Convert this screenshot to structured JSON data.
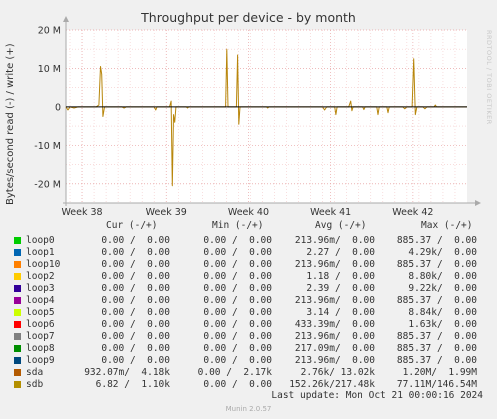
{
  "chart_data": {
    "type": "line",
    "title": "Throughput per device - by month",
    "ylabel": "Bytes/second read (-) / write (+)",
    "ylim": [
      -25000000,
      20000000
    ],
    "yticks": [
      {
        "value": 20000000,
        "label": "20 M"
      },
      {
        "value": 10000000,
        "label": "10 M"
      },
      {
        "value": 0,
        "label": "0"
      },
      {
        "value": -10000000,
        "label": "-10 M"
      },
      {
        "value": -20000000,
        "label": "-20 M"
      }
    ],
    "xlim": [
      0,
      1
    ],
    "xticks": [
      {
        "value": 0.04,
        "label": "Week 38"
      },
      {
        "value": 0.25,
        "label": "Week 39"
      },
      {
        "value": 0.455,
        "label": "Week 40"
      },
      {
        "value": 0.66,
        "label": "Week 41"
      },
      {
        "value": 0.865,
        "label": "Week 42"
      }
    ],
    "grid": true,
    "series": [
      {
        "name": "sdb",
        "color": "#b8860b",
        "points": [
          [
            0.0,
            0
          ],
          [
            0.005,
            -800000
          ],
          [
            0.01,
            0
          ],
          [
            0.02,
            -300000
          ],
          [
            0.03,
            0
          ],
          [
            0.075,
            0
          ],
          [
            0.082,
            500000
          ],
          [
            0.086,
            10500000
          ],
          [
            0.089,
            8500000
          ],
          [
            0.092,
            -2500000
          ],
          [
            0.096,
            0
          ],
          [
            0.14,
            0
          ],
          [
            0.145,
            -300000
          ],
          [
            0.15,
            0
          ],
          [
            0.22,
            0
          ],
          [
            0.224,
            -800000
          ],
          [
            0.227,
            0
          ],
          [
            0.258,
            0
          ],
          [
            0.262,
            1500000
          ],
          [
            0.265,
            -20500000
          ],
          [
            0.268,
            -2000000
          ],
          [
            0.271,
            -4000000
          ],
          [
            0.274,
            0
          ],
          [
            0.3,
            0
          ],
          [
            0.303,
            -300000
          ],
          [
            0.306,
            0
          ],
          [
            0.398,
            0
          ],
          [
            0.401,
            15000000
          ],
          [
            0.404,
            0
          ],
          [
            0.425,
            0
          ],
          [
            0.428,
            13500000
          ],
          [
            0.431,
            -4500000
          ],
          [
            0.434,
            0
          ],
          [
            0.5,
            0
          ],
          [
            0.503,
            -300000
          ],
          [
            0.506,
            0
          ],
          [
            0.64,
            0
          ],
          [
            0.645,
            -800000
          ],
          [
            0.65,
            0
          ],
          [
            0.67,
            0
          ],
          [
            0.673,
            -2000000
          ],
          [
            0.676,
            0
          ],
          [
            0.705,
            0
          ],
          [
            0.71,
            1500000
          ],
          [
            0.713,
            -1000000
          ],
          [
            0.716,
            0
          ],
          [
            0.74,
            0
          ],
          [
            0.743,
            -700000
          ],
          [
            0.746,
            0
          ],
          [
            0.775,
            0
          ],
          [
            0.778,
            -2000000
          ],
          [
            0.781,
            0
          ],
          [
            0.8,
            0
          ],
          [
            0.803,
            -1500000
          ],
          [
            0.806,
            0
          ],
          [
            0.84,
            0
          ],
          [
            0.845,
            -500000
          ],
          [
            0.85,
            0
          ],
          [
            0.863,
            0
          ],
          [
            0.867,
            12500000
          ],
          [
            0.871,
            -2000000
          ],
          [
            0.875,
            0
          ],
          [
            0.89,
            0
          ],
          [
            0.895,
            -500000
          ],
          [
            0.9,
            0
          ],
          [
            0.918,
            0
          ],
          [
            0.921,
            500000
          ],
          [
            0.924,
            0
          ],
          [
            1.0,
            0
          ]
        ]
      },
      {
        "name": "loop0",
        "color": "#000000",
        "points": [
          [
            0.0,
            0
          ],
          [
            1.0,
            0
          ]
        ]
      }
    ]
  },
  "side_label": "RRDTOOL / TOBI OETIKER",
  "legend": {
    "columns": [
      "Cur (-/+)",
      "Min (-/+)",
      "Avg (-/+)",
      "Max (-/+)"
    ],
    "rows": [
      {
        "name": "loop0",
        "color": "#00cc00",
        "cur": "0.00 /  0.00",
        "min": "0.00 /  0.00",
        "avg": "213.96m/  0.00",
        "max": "885.37 /  0.00"
      },
      {
        "name": "loop1",
        "color": "#0066b3",
        "cur": "0.00 /  0.00",
        "min": "0.00 /  0.00",
        "avg": "2.27 /  0.00",
        "max": "4.29k/  0.00"
      },
      {
        "name": "loop10",
        "color": "#ff8000",
        "cur": "0.00 /  0.00",
        "min": "0.00 /  0.00",
        "avg": "213.96m/  0.00",
        "max": "885.37 /  0.00"
      },
      {
        "name": "loop2",
        "color": "#ffcc00",
        "cur": "0.00 /  0.00",
        "min": "0.00 /  0.00",
        "avg": "1.18 /  0.00",
        "max": "8.80k/  0.00"
      },
      {
        "name": "loop3",
        "color": "#330099",
        "cur": "0.00 /  0.00",
        "min": "0.00 /  0.00",
        "avg": "2.39 /  0.00",
        "max": "9.22k/  0.00"
      },
      {
        "name": "loop4",
        "color": "#990099",
        "cur": "0.00 /  0.00",
        "min": "0.00 /  0.00",
        "avg": "213.96m/  0.00",
        "max": "885.37 /  0.00"
      },
      {
        "name": "loop5",
        "color": "#ccff00",
        "cur": "0.00 /  0.00",
        "min": "0.00 /  0.00",
        "avg": "3.14 /  0.00",
        "max": "8.84k/  0.00"
      },
      {
        "name": "loop6",
        "color": "#ff0000",
        "cur": "0.00 /  0.00",
        "min": "0.00 /  0.00",
        "avg": "433.39m/  0.00",
        "max": "1.63k/  0.00"
      },
      {
        "name": "loop7",
        "color": "#808080",
        "cur": "0.00 /  0.00",
        "min": "0.00 /  0.00",
        "avg": "213.96m/  0.00",
        "max": "885.37 /  0.00"
      },
      {
        "name": "loop8",
        "color": "#008f00",
        "cur": "0.00 /  0.00",
        "min": "0.00 /  0.00",
        "avg": "217.09m/  0.00",
        "max": "885.37 /  0.00"
      },
      {
        "name": "loop9",
        "color": "#00487d",
        "cur": "0.00 /  0.00",
        "min": "0.00 /  0.00",
        "avg": "213.96m/  0.00",
        "max": "885.37 /  0.00"
      },
      {
        "name": "sda",
        "color": "#b35a00",
        "cur": "932.07m/  4.18k",
        "min": "0.00 /  2.17k",
        "avg": "2.76k/ 13.02k",
        "max": "1.20M/  1.99M"
      },
      {
        "name": "sdb",
        "color": "#b38f00",
        "cur": "6.82 /  1.10k",
        "min": "0.00 /  0.00",
        "avg": "152.26k/217.48k",
        "max": "77.11M/146.54M"
      }
    ]
  },
  "last_update": "Last update: Mon Oct 21 00:00:16 2024",
  "footer": "Munin 2.0.57"
}
